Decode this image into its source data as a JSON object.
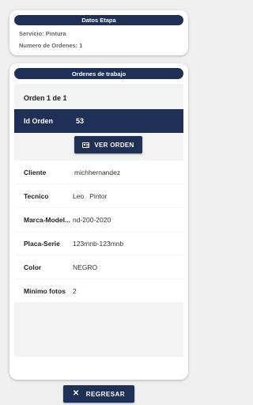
{
  "stage_card": {
    "header": "Datos Etapa",
    "service_label": "Servicio:",
    "service_value": "Pintura",
    "orders_label": "Numero de Ordenes:",
    "orders_value": "1"
  },
  "orders_card": {
    "header": "Ordenes de trabajo",
    "order_count": "Orden 1 de 1",
    "id_label": "Id Orden",
    "id_value": "53",
    "view_button": "VER ORDEN",
    "view_icon": "card-icon",
    "rows": [
      {
        "label": "Cliente",
        "value": "michhernandez"
      },
      {
        "label": "Tecnico",
        "value": "Leo   Pintor"
      },
      {
        "label": "Marca-Model...",
        "value": "nd-200-2020"
      },
      {
        "label": "Placa-Serie",
        "value": "123mnb-123mnb"
      },
      {
        "label": "Color",
        "value": "NEGRO"
      },
      {
        "label": "Minimo fotos",
        "value": "2"
      }
    ]
  },
  "back_button": {
    "label": "REGRESAR",
    "icon": "close-icon"
  },
  "colors": {
    "primary": "#1f3056",
    "background": "#efefef",
    "card": "#ffffff"
  }
}
